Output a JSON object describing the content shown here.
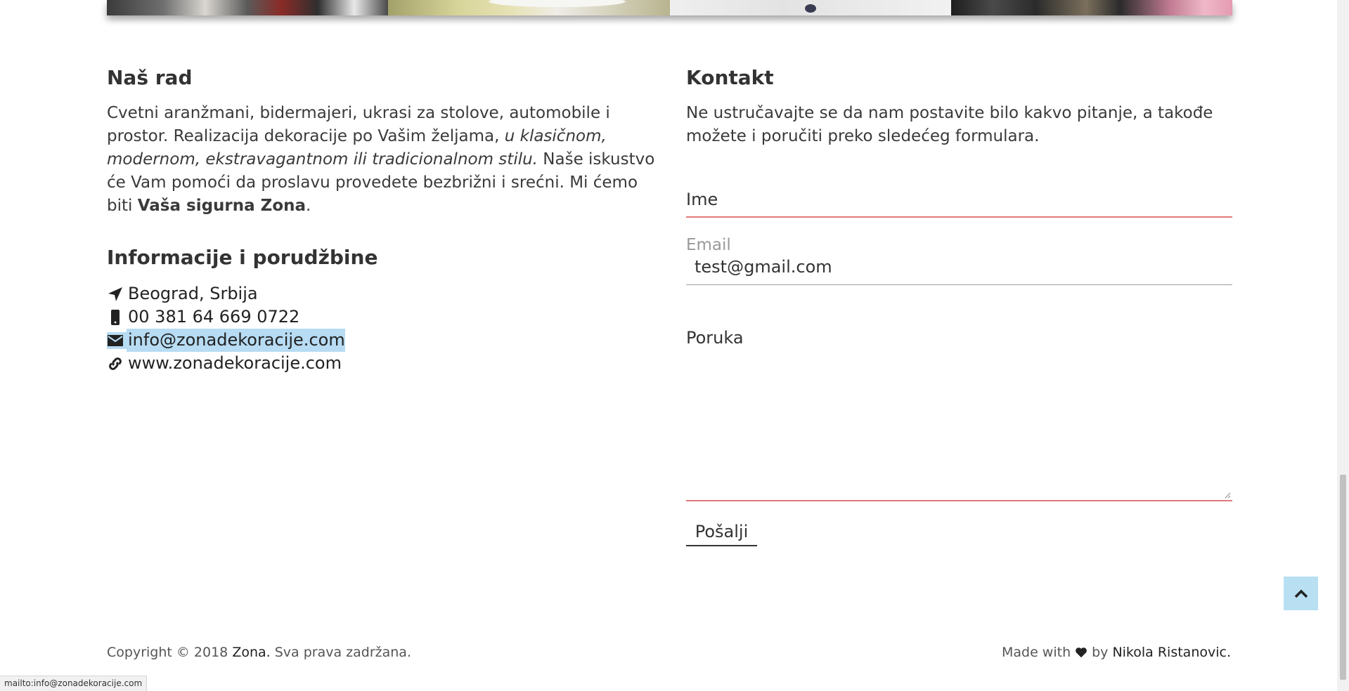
{
  "about": {
    "heading": "Naš rad",
    "p_part1": "Cvetni aranžmani, bidermajeri, ukrasi za stolove, automobile i prostor. Realizacija dekoracije po Vašim željama, ",
    "p_italic": "u klasičnom, modernom, ekstravagantnom ili tradicionalnom stilu.",
    "p_part2": " Naše iskustvo će Vam pomoći da proslavu provedete bezbrižni i srećni. Mi ćemo biti ",
    "p_bold": "Vaša sigurna Zona",
    "p_end": "."
  },
  "info": {
    "heading": "Informacije i porudžbine",
    "items": [
      {
        "icon": "location-arrow-icon",
        "text": "Beograd, Srbija"
      },
      {
        "icon": "mobile-phone-icon",
        "text": "00 381 64 669 0722"
      },
      {
        "icon": "envelope-icon",
        "text": "info@zonadekoracije.com"
      },
      {
        "icon": "link-icon",
        "text": "www.zonadekoracije.com"
      }
    ]
  },
  "contact": {
    "heading": "Kontakt",
    "intro": "Ne ustručavajte se da nam postavite bilo kakvo pitanje, a takođe možete i poručiti preko sledećeg formulara.",
    "name_label": "Ime",
    "email_label": "Email",
    "email_value": "test@gmail.com",
    "message_label": "Poruka",
    "submit_label": "Pošalji"
  },
  "footer": {
    "copyright_prefix": "Copyright © 2018 ",
    "brand": "Zona.",
    "copyright_suffix": " Sva prava zadržana.",
    "made_with": "Made with",
    "by": "by",
    "author": "Nikola Ristanovic."
  },
  "status_bar": {
    "url": "mailto:info@zonadekoracije.com"
  },
  "colors": {
    "accent_underline": "#e07a7a",
    "link_highlight": "#b7dcf3",
    "scroll_top_bg": "#b9dff2"
  }
}
